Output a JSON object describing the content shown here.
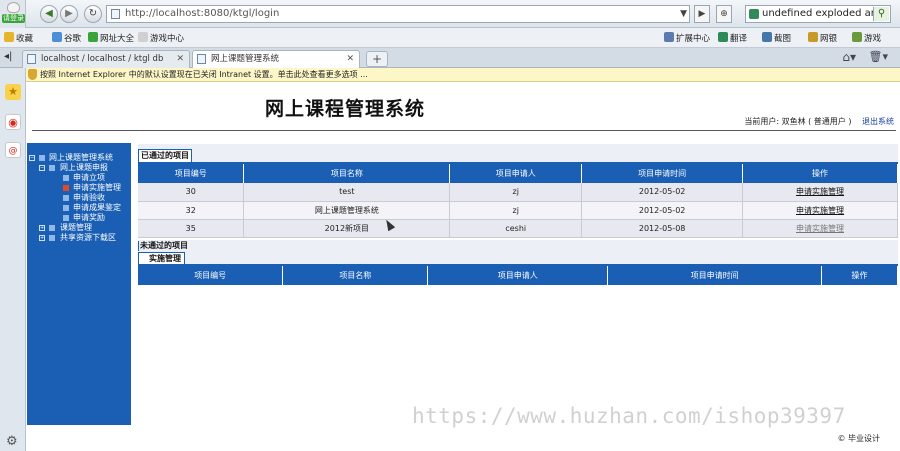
{
  "browser": {
    "login_label": "请登录",
    "url": "http://localhost:8080/ktgl/login",
    "search_text": "undefined exploded archi",
    "favorites": [
      {
        "label": "收藏",
        "color": "#e7b52b"
      },
      {
        "label": "谷歌",
        "color": "#4a8fd8"
      },
      {
        "label": "网址大全",
        "color": "#3aa43a"
      },
      {
        "label": "游戏中心",
        "color": "#d0d0d0"
      }
    ],
    "tools": [
      {
        "label": "扩展中心",
        "color": "#5a7ab0"
      },
      {
        "label": "翻译",
        "color": "#2e8b57"
      },
      {
        "label": "截图",
        "color": "#4477aa"
      },
      {
        "label": "网银",
        "color": "#c89a2a"
      },
      {
        "label": "游戏",
        "color": "#6a9a3a"
      }
    ],
    "tabs": [
      {
        "label": "localhost / localhost / ktgl db"
      },
      {
        "label": "网上课题管理系统"
      }
    ],
    "infobar": "按照 Internet Explorer 中的默认设置现在已关闭 Intranet 设置。单击此处查看更多选项 ..."
  },
  "page": {
    "title": "网上课程管理系统",
    "user_label": "当前用户: 双鱼林 ( 普通用户 )",
    "logout": "退出系统",
    "footer": "© 毕业设计"
  },
  "sidebar": {
    "root": "网上课题管理系统",
    "apply": "网上课题申报",
    "items": [
      "申请立项",
      "申请实施管理",
      "申请验收",
      "申请成果鉴定",
      "申请奖励"
    ],
    "topic_mgmt": "课题管理",
    "share": "共享资源下载区"
  },
  "approved": {
    "title": "已通过的项目",
    "headers": [
      "项目编号",
      "项目名称",
      "项目申请人",
      "项目申请时间",
      "操作"
    ],
    "rows": [
      {
        "id": "30",
        "name": "test",
        "applicant": "zj",
        "date": "2012-05-02",
        "action": "申请实施管理"
      },
      {
        "id": "32",
        "name": "网上课题管理系统",
        "applicant": "zj",
        "date": "2012-05-02",
        "action": "申请实施管理"
      },
      {
        "id": "35",
        "name": "2012新项目",
        "applicant": "ceshi",
        "date": "2012-05-08",
        "action": "申请实施管理"
      }
    ]
  },
  "pending": {
    "title": "未通过的项目",
    "subtitle": "实施管理",
    "headers": [
      "项目编号",
      "项目名称",
      "项目申请人",
      "项目申请时间",
      "操作"
    ]
  },
  "watermark": "https://www.huzhan.com/ishop39397"
}
